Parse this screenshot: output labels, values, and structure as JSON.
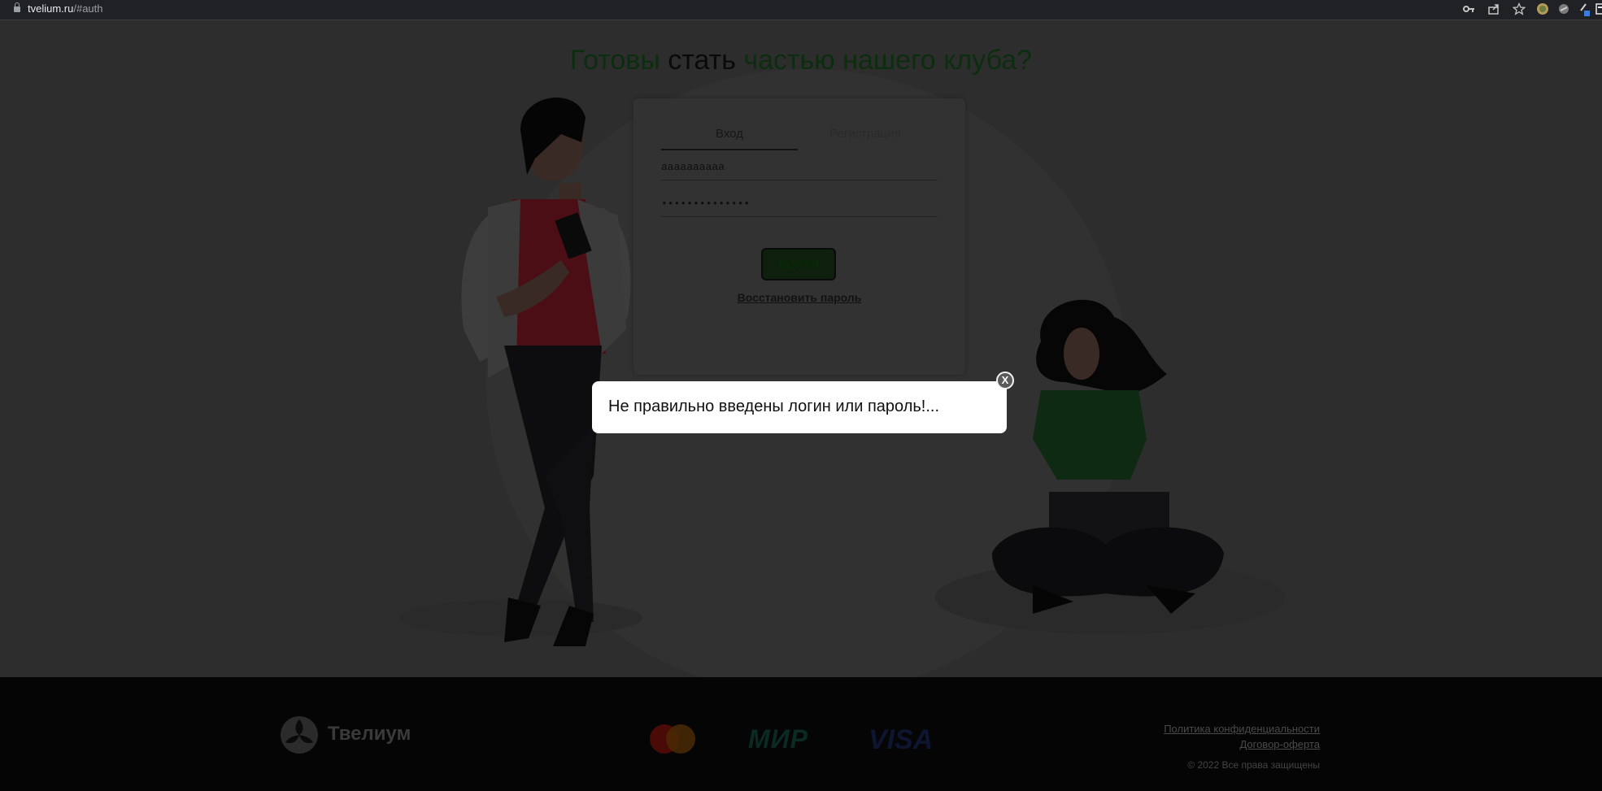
{
  "browser": {
    "domain": "tvelium.ru",
    "path": "/#auth",
    "icons": [
      "lock-icon",
      "key-icon",
      "share-icon",
      "star-icon",
      "extension-icon",
      "extension-icon",
      "extension-icon",
      "puzzle-icon"
    ]
  },
  "hero": {
    "headline_part1": "Готовы ",
    "headline_strong": "стать",
    "headline_part2": " частью нашего клуба?"
  },
  "auth_form": {
    "tabs": [
      {
        "label": "Вход",
        "active": true
      },
      {
        "label": "Регистрация",
        "active": false
      }
    ],
    "login_value": "aaaaaaaaaa",
    "password_value": "••••••••••••••",
    "submit_label": "ВОЙТИ",
    "restore_label": "Восстановить пароль"
  },
  "error_popup": {
    "message": "Не правильно введены логин или пароль!...",
    "close_label": "X"
  },
  "footer": {
    "brand": "Твелиум",
    "payment_logos": [
      "mastercard-logo",
      "mir-logo",
      "visa-logo"
    ],
    "mir_text": "МИР",
    "visa_text": "VISA",
    "links": [
      "Политика конфиденциальности",
      "Договор-оферта"
    ],
    "copyright": "© 2022 Все права защищены"
  },
  "colors": {
    "overlay_bg": "#2d2d2d",
    "footer_bg": "#050505",
    "accent_green": "#0e1f0e",
    "popup_bg": "#ffffff"
  }
}
